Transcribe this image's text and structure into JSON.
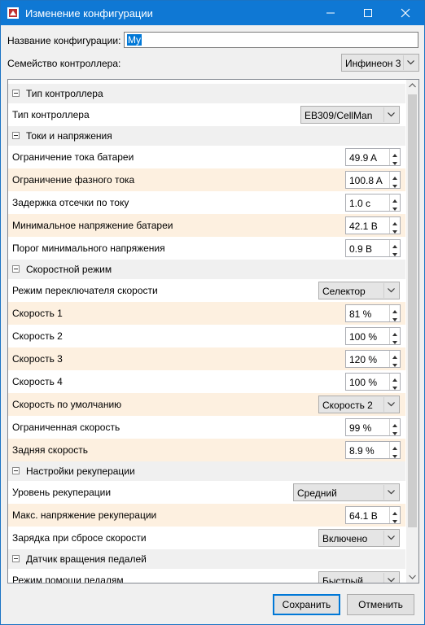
{
  "window": {
    "title": "Изменение конфигурации"
  },
  "header": {
    "name_label": "Название конфигурации:",
    "name_value": "My",
    "family_label": "Семейство контроллера:",
    "family_value": "Инфинеон 3"
  },
  "grid": {
    "sections": [
      {
        "title": "Тип контроллера",
        "rows": [
          {
            "label": "Тип контроллера",
            "value": "EB309/CellMan",
            "kind": "combo"
          }
        ]
      },
      {
        "title": "Токи и напряжения",
        "rows": [
          {
            "label": "Ограничение тока батареи",
            "value": "49.9 A",
            "kind": "spin"
          },
          {
            "label": "Ограничение фазного тока",
            "value": "100.8 A",
            "kind": "spin"
          },
          {
            "label": "Задержка отсечки по току",
            "value": "1.0 с",
            "kind": "spin"
          },
          {
            "label": "Минимальное напряжение батареи",
            "value": "42.1 В",
            "kind": "spin"
          },
          {
            "label": "Порог минимального напряжения",
            "value": "0.9 В",
            "kind": "spin"
          }
        ]
      },
      {
        "title": "Скоростной режим",
        "rows": [
          {
            "label": "Режим переключателя скорости",
            "value": "Селектор",
            "kind": "combo"
          },
          {
            "label": "Скорость 1",
            "value": "81 %",
            "kind": "spin"
          },
          {
            "label": "Скорость 2",
            "value": "100 %",
            "kind": "spin"
          },
          {
            "label": "Скорость 3",
            "value": "120 %",
            "kind": "spin"
          },
          {
            "label": "Скорость 4",
            "value": "100 %",
            "kind": "spin"
          },
          {
            "label": "Скорость по умолчанию",
            "value": "Скорость 2",
            "kind": "combo"
          },
          {
            "label": "Ограниченная скорость",
            "value": "99 %",
            "kind": "spin"
          },
          {
            "label": "Задняя скорость",
            "value": "8.9 %",
            "kind": "spin"
          }
        ]
      },
      {
        "title": "Настройки рекуперации",
        "rows": [
          {
            "label": "Уровень рекуперации",
            "value": "Средний",
            "kind": "combo"
          },
          {
            "label": "Макс. напряжение рекуперации",
            "value": "64.1 В",
            "kind": "spin"
          },
          {
            "label": "Зарядка при сбросе скорости",
            "value": "Включено",
            "kind": "combo"
          }
        ]
      },
      {
        "title": "Датчик вращения педалей",
        "rows": [
          {
            "label": "Режим помощи педалям",
            "value": "Быстрый",
            "kind": "combo"
          }
        ]
      }
    ]
  },
  "buttons": {
    "save": "Сохранить",
    "cancel": "Отменить"
  },
  "colors": {
    "titlebar": "#0f78d4",
    "alt_row": "#fdf0e0",
    "selection": "#0078d7"
  }
}
